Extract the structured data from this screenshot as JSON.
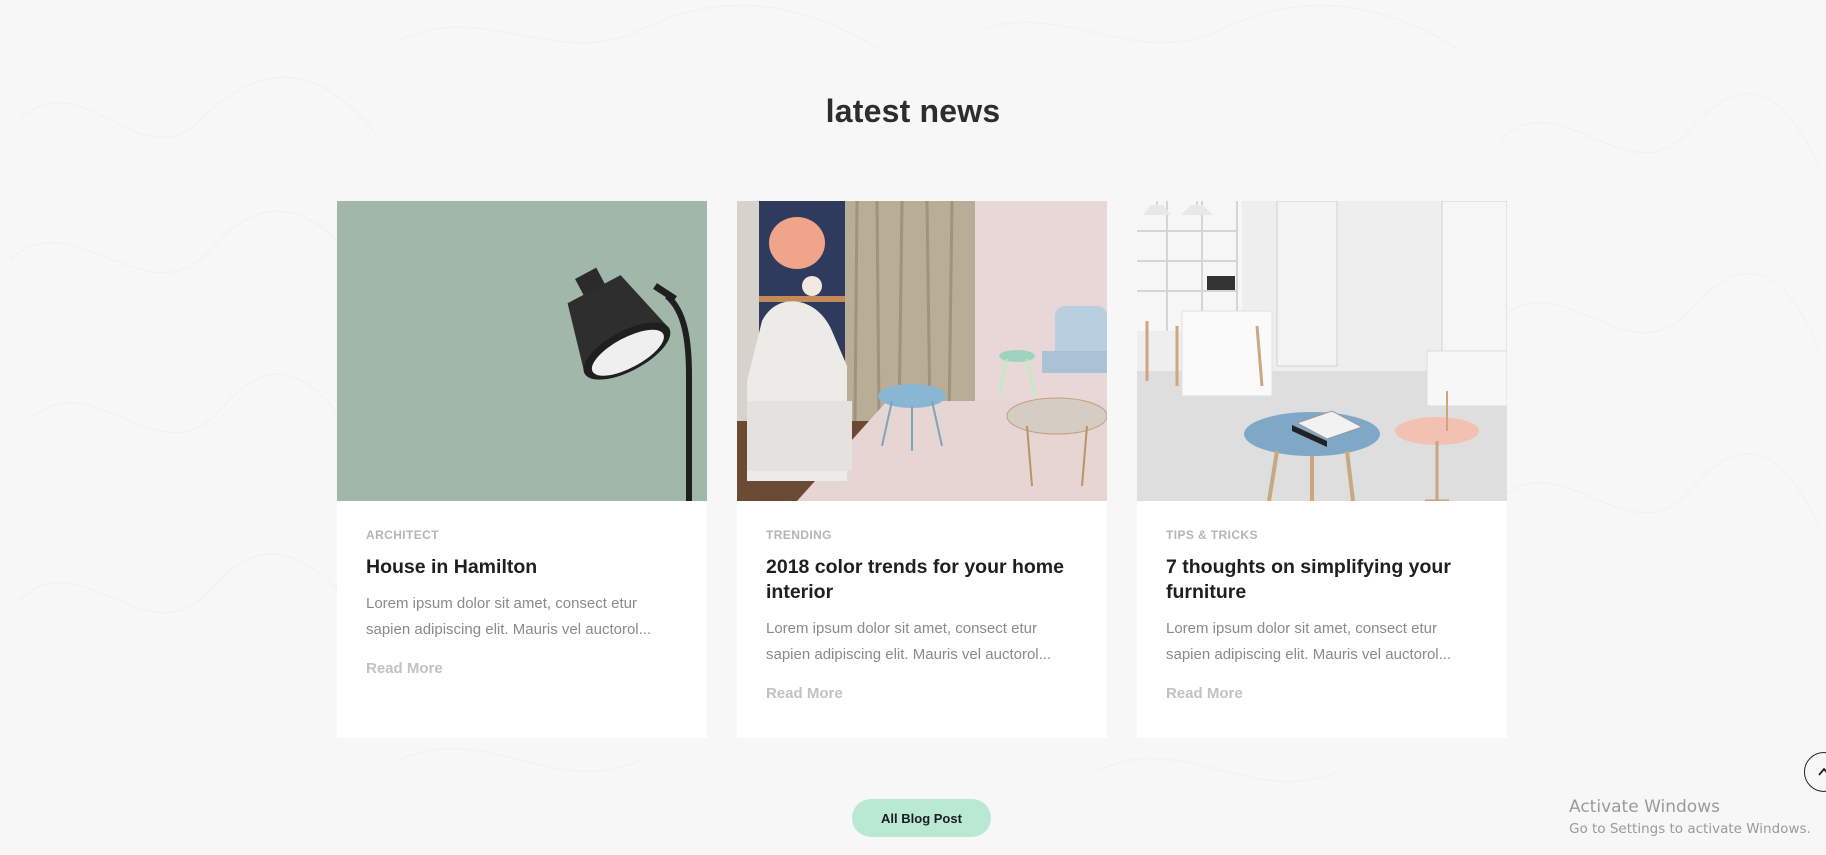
{
  "section": {
    "title": "latest news"
  },
  "posts": [
    {
      "category": "ARCHITECT",
      "title": "House in Hamilton",
      "excerpt": "Lorem ipsum dolor sit amet, consect etur sapien adipiscing elit. Mauris vel auctorol...",
      "read_more": "Read More",
      "image": "floor-lamp-on-sage-wall"
    },
    {
      "category": "TRENDING",
      "title": "2018 color trends for your home interior",
      "excerpt": "Lorem ipsum dolor sit amet, consect etur sapien adipiscing elit. Mauris vel auctorol...",
      "read_more": "Read More",
      "image": "pastel-living-room"
    },
    {
      "category": "TIPS & TRICKS",
      "title": "7 thoughts on simplifying your furniture",
      "excerpt": "Lorem ipsum dolor sit amet, consect etur sapien adipiscing elit. Mauris vel auctorol...",
      "read_more": "Read More",
      "image": "white-kitchen-blue-table"
    }
  ],
  "footer": {
    "button_label": "All Blog Post"
  },
  "scroll_top": {
    "icon": "chevron-up-icon"
  },
  "watermark": {
    "title": "Activate Windows",
    "subtitle": "Go to Settings to activate Windows."
  },
  "colors": {
    "background": "#f7f7f7",
    "button_accent": "#b9e8d3",
    "card": "#ffffff",
    "muted_text": "#8a8a8a"
  }
}
